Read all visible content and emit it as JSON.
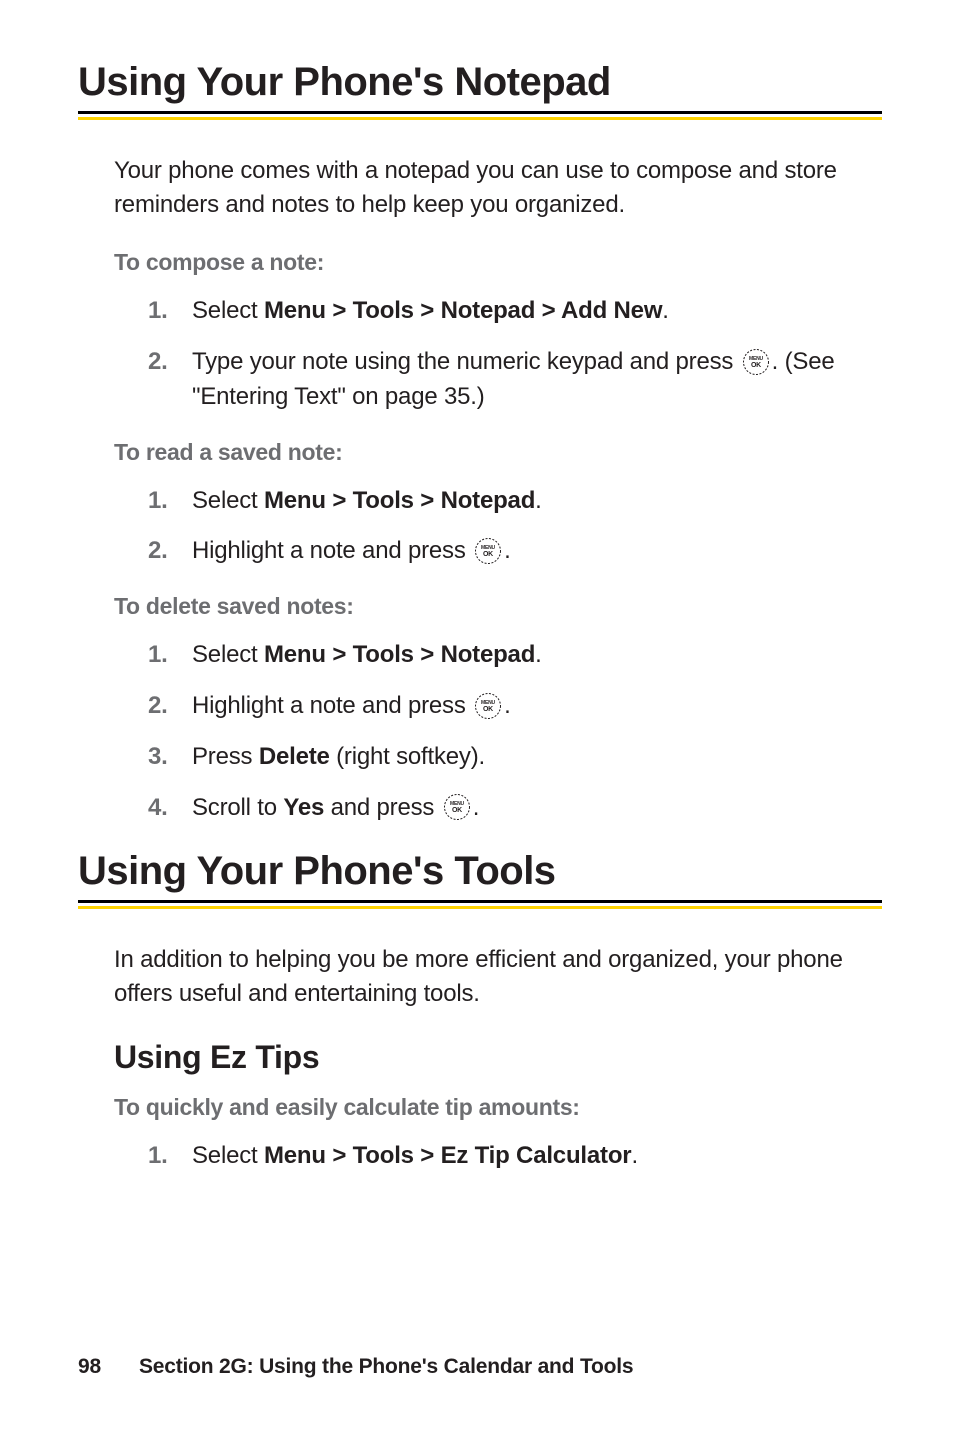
{
  "sections": [
    {
      "title": "Using Your Phone's Notepad",
      "intro": "Your phone comes with a notepad you can use to compose and store reminders and notes to help keep you organized.",
      "blocks": [
        {
          "heading": "To compose a note:",
          "steps": [
            {
              "num": "1.",
              "pre": "Select ",
              "bold": "Menu > Tools > Notepad > Add New",
              "post": "."
            },
            {
              "num": "2.",
              "pre": "Type your note using the numeric keypad and press ",
              "icon": true,
              "post": ". (See \"Entering Text\" on page 35.)"
            }
          ]
        },
        {
          "heading": "To read a saved note:",
          "steps": [
            {
              "num": "1.",
              "pre": "Select ",
              "bold": "Menu > Tools > Notepad",
              "post": "."
            },
            {
              "num": "2.",
              "pre": "Highlight a note and press ",
              "icon": true,
              "post": "."
            }
          ]
        },
        {
          "heading": "To delete saved notes:",
          "steps": [
            {
              "num": "1.",
              "pre": "Select ",
              "bold": "Menu > Tools > Notepad",
              "post": "."
            },
            {
              "num": "2.",
              "pre": "Highlight a note and press ",
              "icon": true,
              "post": "."
            },
            {
              "num": "3.",
              "pre": "Press ",
              "bold": "Delete",
              "post": " (right softkey)."
            },
            {
              "num": "4.",
              "pre": "Scroll to ",
              "bold": "Yes",
              "post_pre_icon": " and press ",
              "icon": true,
              "post": "."
            }
          ]
        }
      ]
    },
    {
      "title": "Using Your Phone's Tools",
      "intro": "In addition to helping you be more efficient and organized, your phone offers useful and entertaining tools.",
      "subsections": [
        {
          "title": "Using Ez Tips",
          "heading": "To quickly and easily calculate tip amounts:",
          "steps": [
            {
              "num": "1.",
              "pre": "Select ",
              "bold": "Menu > Tools > Ez Tip Calculator",
              "post": "."
            }
          ]
        }
      ]
    }
  ],
  "footer": {
    "page": "98",
    "label": "Section 2G: Using the Phone's Calendar and Tools"
  },
  "icon_label": "MENU OK"
}
